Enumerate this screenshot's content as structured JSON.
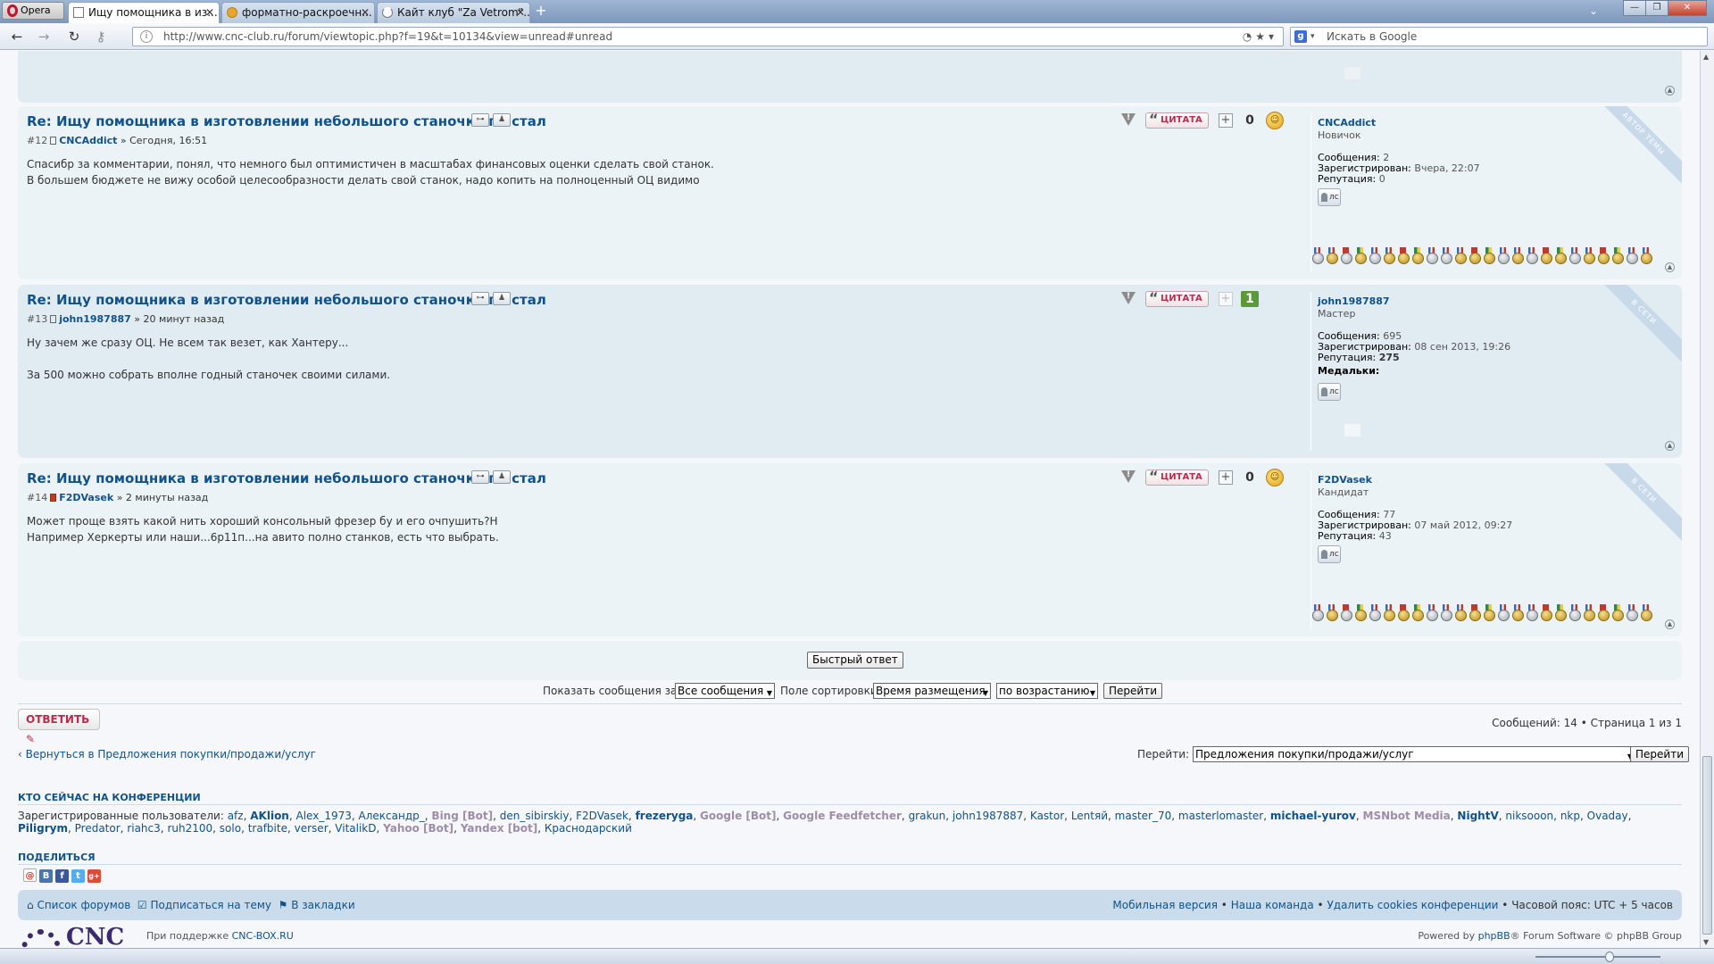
{
  "browser": {
    "menu_label": "Opera",
    "tabs": [
      {
        "title": "Ищу помощника в из..."
      },
      {
        "title": "форматно-раскроечн..."
      },
      {
        "title": "Кайт клуб \"Za Vetrom\"..."
      }
    ],
    "url": "http://www.cnc-club.ru/forum/viewtopic.php?f=19&t=10134&view=unread#unread",
    "search_placeholder": "Искать в Google"
  },
  "posts": [
    {
      "title": "Re: Ищу помощника в изготовлении небольшого станочка по стал",
      "number": "#12",
      "author": "CNCAddict",
      "time": "» Сегодня, 16:51",
      "body": [
        "Спасибр за комментарии, понял, что немного был оптимистичен в масштабах финансовых оценки сделать свой станок.",
        "В большем бюджете не вижу особой целесообразности делать свой станок, надо копить на полноценный ОЦ видимо"
      ],
      "quote_label": "ЦИТАТА",
      "rating": "0",
      "profile": {
        "name": "CNCAddict",
        "rank": "Новичок",
        "stats": [
          {
            "k": "Сообщения:",
            "v": "2"
          },
          {
            "k": "Зарегистрирован:",
            "v": "Вчера, 22:07"
          },
          {
            "k": "Репутация:",
            "v": "0"
          }
        ],
        "pm_label": "лс",
        "ribbon": "АВТОР ТЕМЫ"
      }
    },
    {
      "title": "Re: Ищу помощника в изготовлении небольшого станочка по стал",
      "number": "#13",
      "author": "john1987887",
      "time": "» 20 минут назад",
      "body": [
        "Ну зачем же сразу ОЦ. Не всем так везет, как Хантеру...",
        "",
        "За 500 можно собрать вполне годный станочек своими силами."
      ],
      "quote_label": "ЦИТАТА",
      "rating": "1",
      "profile": {
        "name": "john1987887",
        "rank": "Мастер",
        "stats": [
          {
            "k": "Сообщения:",
            "v": "695"
          },
          {
            "k": "Зарегистрирован:",
            "v": "08 сен 2013, 19:26"
          },
          {
            "k": "Репутация:",
            "v": "275"
          },
          {
            "k": "Медальки:",
            "v": ""
          }
        ],
        "pm_label": "лс",
        "ribbon": "В СЕТИ"
      }
    },
    {
      "title": "Re: Ищу помощника в изготовлении небольшого станочка по стал",
      "number": "#14",
      "author": "F2DVasek",
      "time": "» 2 минуты назад",
      "body": [
        "Может проще взять какой нить хороший консольный фрезер бу и его очпушить?Н",
        "Например Херкерты или наши...6р11п...на авито полно станков, есть что выбрать."
      ],
      "quote_label": "ЦИТАТА",
      "rating": "0",
      "profile": {
        "name": "F2DVasek",
        "rank": "Кандидат",
        "stats": [
          {
            "k": "Сообщения:",
            "v": "77"
          },
          {
            "k": "Зарегистрирован:",
            "v": "07 май 2012, 09:27"
          },
          {
            "k": "Репутация:",
            "v": "43"
          }
        ],
        "pm_label": "лс",
        "ribbon": "В СЕТИ"
      }
    }
  ],
  "quick_reply_label": "Быстрый ответ",
  "sort": {
    "show_label": "Показать сообщения за:",
    "show_value": "Все сообщения",
    "sort_label": "Поле сортировки",
    "sort_value": "Время размещения",
    "order_value": "по возрастанию",
    "go_label": "Перейти"
  },
  "reply_label": "ОТВЕТИТЬ",
  "pagination": "Сообщений: 14 • Страница 1 из 1",
  "back_link": "Вернуться в Предложения покупки/продажи/услуг",
  "jump": {
    "label": "Перейти:",
    "value": "Предложения покупки/продажи/услуг",
    "go": "Перейти"
  },
  "online": {
    "heading": "КТО СЕЙЧАС НА КОНФЕРЕНЦИИ",
    "prefix": "Зарегистрированные пользователи:",
    "users": [
      {
        "n": "afz",
        "t": "u"
      },
      {
        "n": "AKlion",
        "t": "b"
      },
      {
        "n": "Alex_1973",
        "t": "u"
      },
      {
        "n": "Александр_",
        "t": "u"
      },
      {
        "n": "Bing [Bot]",
        "t": "bot"
      },
      {
        "n": "den_sibirskiy",
        "t": "u"
      },
      {
        "n": "F2DVasek",
        "t": "u"
      },
      {
        "n": "frezeryga",
        "t": "b"
      },
      {
        "n": "Google [Bot]",
        "t": "bot"
      },
      {
        "n": "Google Feedfetcher",
        "t": "bot"
      },
      {
        "n": "grakun",
        "t": "u"
      },
      {
        "n": "john1987887",
        "t": "u"
      },
      {
        "n": "Kastor",
        "t": "u"
      },
      {
        "n": "Lentяй",
        "t": "u"
      },
      {
        "n": "master_70",
        "t": "u"
      },
      {
        "n": "masterlomaster",
        "t": "u"
      },
      {
        "n": "michael-yurov",
        "t": "b"
      },
      {
        "n": "MSNbot Media",
        "t": "bot"
      },
      {
        "n": "NightV",
        "t": "b"
      },
      {
        "n": "niksooon",
        "t": "u"
      },
      {
        "n": "nkp",
        "t": "u"
      },
      {
        "n": "Ovaday",
        "t": "u"
      },
      {
        "n": "Piligrym",
        "t": "b"
      },
      {
        "n": "Predator",
        "t": "u"
      },
      {
        "n": "riahc3",
        "t": "u"
      },
      {
        "n": "ruh2100",
        "t": "u"
      },
      {
        "n": "solo",
        "t": "u"
      },
      {
        "n": "trafbite",
        "t": "u"
      },
      {
        "n": "verser",
        "t": "u"
      },
      {
        "n": "VitalikD",
        "t": "u"
      },
      {
        "n": "Yahoo [Bot]",
        "t": "bot"
      },
      {
        "n": "Yandex [bot]",
        "t": "bot"
      },
      {
        "n": "Краснодарский",
        "t": "u"
      }
    ]
  },
  "share": {
    "heading": "ПОДЕЛИТЬСЯ",
    "icons": [
      "В",
      "f",
      "t",
      "g+"
    ]
  },
  "footer": {
    "index": "Список форумов",
    "subscribe": "Подписаться на тему",
    "bookmark": "В закладки",
    "mobile": "Мобильная версия",
    "team": "Наша команда",
    "cookies": "Удалить cookies конференции",
    "timezone": "Часовой пояс: UTC + 5 часов",
    "logo": "CNC",
    "support_prefix": "При поддержке",
    "support_link": "CNC-BOX.RU",
    "powered_prefix": "Powered by",
    "powered_link": "phpBB",
    "powered_suffix": "® Forum Software © phpBB Group"
  },
  "colors": {
    "link": "#105289",
    "post_bg": "#e1ebf2",
    "post_bg_alt": "#ecf3f7",
    "quote": "#bc2a4d",
    "rep_positive": "#5a9a3b"
  }
}
